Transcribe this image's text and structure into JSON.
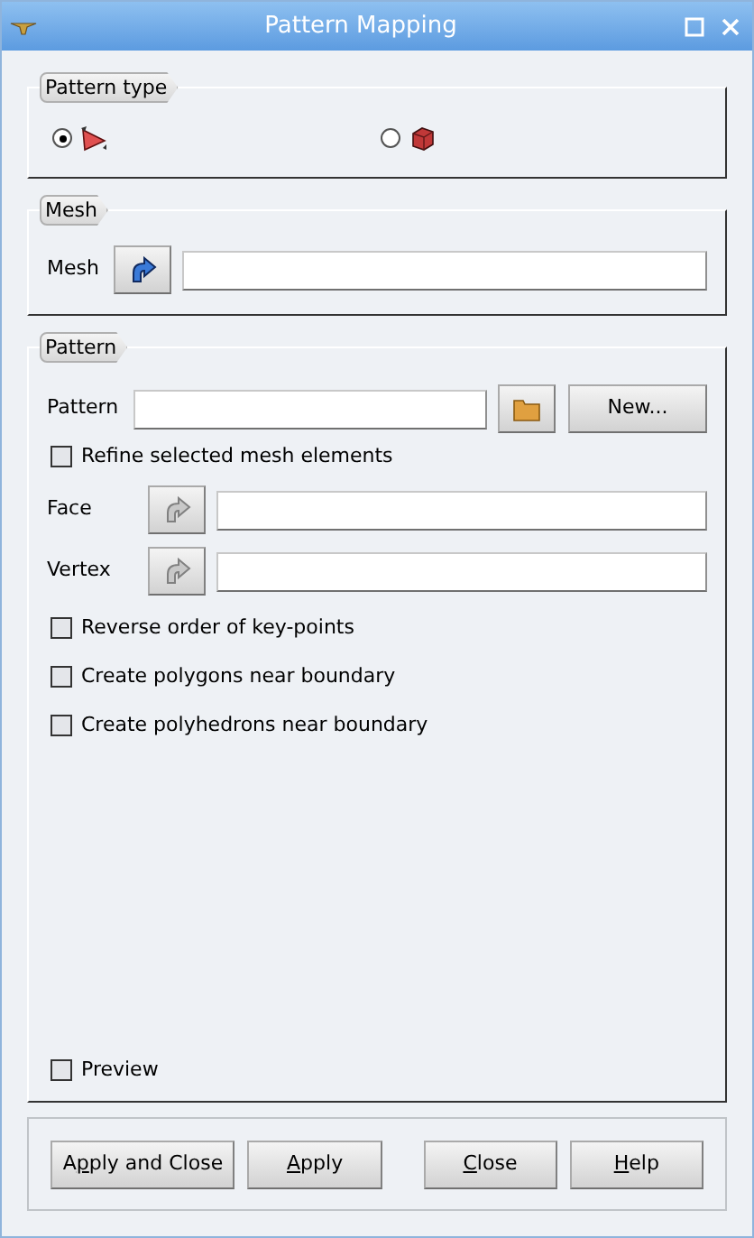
{
  "window": {
    "title": "Pattern Mapping"
  },
  "pattern_type": {
    "title": "Pattern type",
    "options": [
      {
        "kind": "flat",
        "selected": true
      },
      {
        "kind": "solid",
        "selected": false
      }
    ]
  },
  "mesh": {
    "title": "Mesh",
    "label": "Mesh",
    "value_enabled": true
  },
  "pattern": {
    "title": "Pattern",
    "label": "Pattern",
    "new_button": "New...",
    "refine": {
      "label": "Refine selected mesh elements",
      "checked": false
    },
    "selectors": [
      {
        "label": "Face",
        "enabled": false
      },
      {
        "label": "Vertex",
        "enabled": false
      }
    ],
    "options": [
      {
        "label": "Reverse order of key-points",
        "checked": false
      },
      {
        "label": "Create polygons near boundary",
        "checked": false
      },
      {
        "label": "Create polyhedrons near boundary",
        "checked": false
      }
    ],
    "preview": {
      "label": "Preview",
      "checked": false
    }
  },
  "buttons": [
    {
      "before": "A",
      "key": "p",
      "after": "ply and Close"
    },
    {
      "key": "A",
      "after": "pply"
    },
    {
      "key": "C",
      "after": "lose"
    },
    {
      "key": "H",
      "after": "elp"
    }
  ]
}
